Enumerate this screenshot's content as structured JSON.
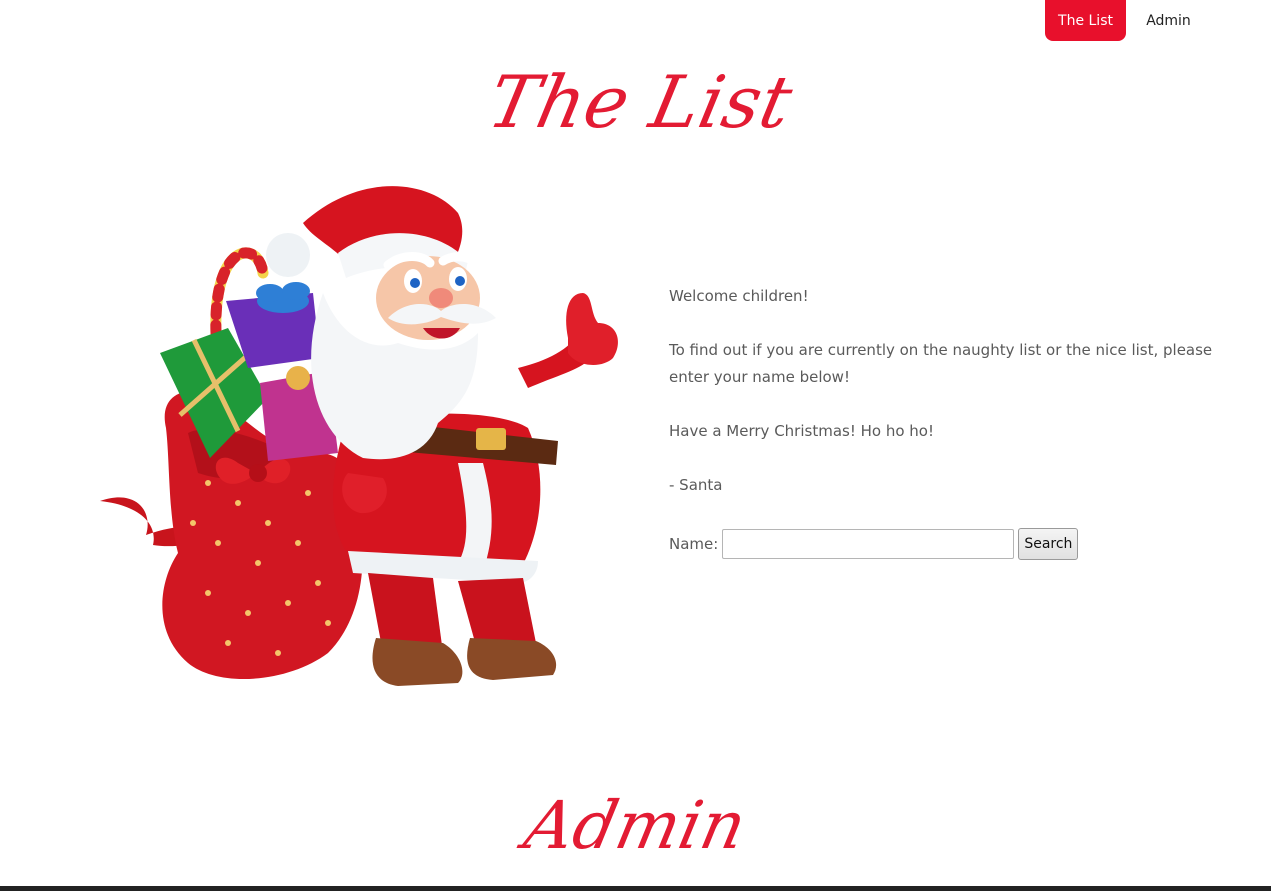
{
  "nav": {
    "items": [
      {
        "label": "The List",
        "active": true
      },
      {
        "label": "Admin",
        "active": false
      }
    ]
  },
  "sections": {
    "thelist_title": "The List",
    "admin_title": "Admin"
  },
  "content": {
    "paragraphs": [
      "Welcome children!",
      "To find out if you are currently on the naughty list or the nice list, please enter your name below!",
      "Have a Merry Christmas! Ho ho ho!",
      "- Santa"
    ]
  },
  "form": {
    "name_label": "Name:",
    "name_value": "",
    "search_label": "Search"
  },
  "colors": {
    "accent": "#e8102c",
    "title": "#e31b33",
    "text": "#5a5a5a"
  }
}
